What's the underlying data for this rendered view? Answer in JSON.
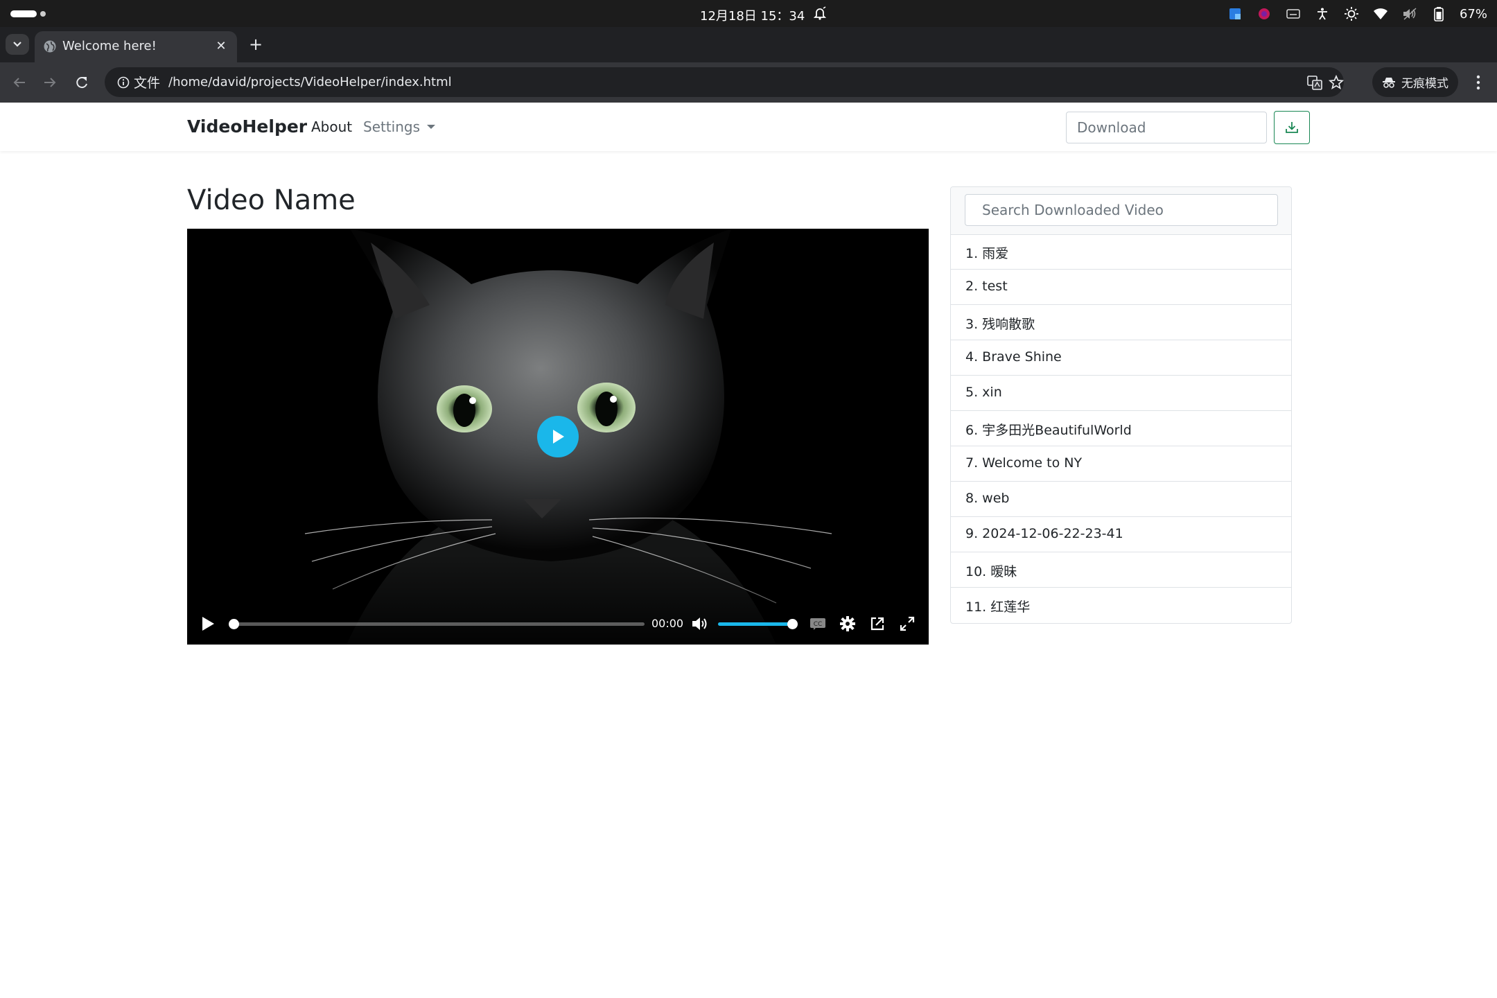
{
  "os": {
    "clock": "12月18日  15：34",
    "battery": "67%"
  },
  "browser": {
    "tab_title": "Welcome here!",
    "site_info_label": "文件",
    "url": "/home/david/projects/VideoHelper/index.html",
    "incognito_label": "无痕模式"
  },
  "navbar": {
    "brand": "VideoHelper",
    "about": "About",
    "settings": "Settings",
    "download_placeholder": "Download"
  },
  "player": {
    "title": "Video Name",
    "time": "00:00",
    "progress": 0,
    "volume": 1.0,
    "accent_color": "#1ab7ea"
  },
  "sidebar": {
    "search_placeholder": "Search Downloaded Video",
    "videos": [
      "1. 雨爱",
      "2. test",
      "3. 残响散歌",
      "4. Brave Shine",
      "5. xin",
      "6. 宇多田光BeautifulWorld",
      "7. Welcome to NY",
      "8. web",
      "9. 2024-12-06-22-23-41",
      "10. 暧昧",
      "11. 红莲华"
    ]
  },
  "colors": {
    "download_button_border": "#198754"
  }
}
